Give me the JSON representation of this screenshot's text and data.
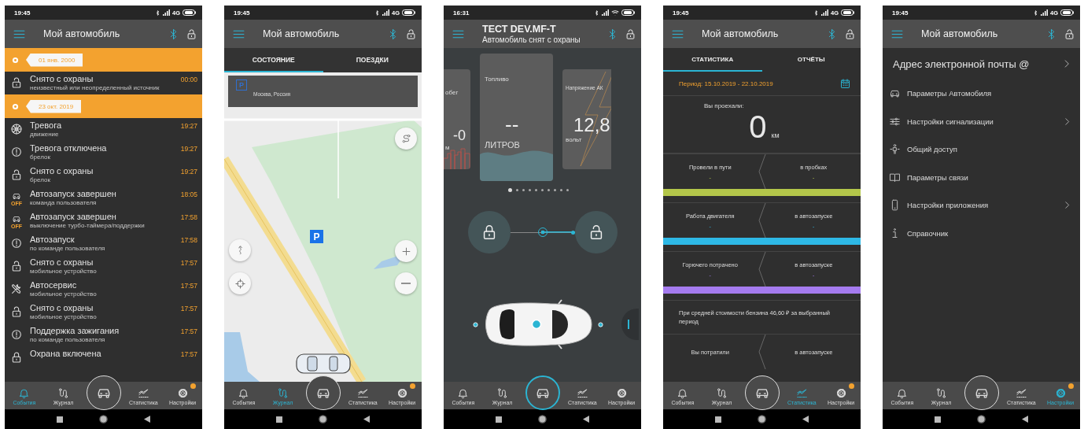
{
  "phones": [
    {
      "status": {
        "time": "19:45",
        "network": "4G"
      },
      "app_bar": {
        "title": "Мой автомобиль"
      },
      "screen": {
        "kind": "events",
        "items": [
          {
            "kind": "date",
            "label": "01 янв. 2000"
          },
          {
            "kind": "disarmed",
            "title": "Снято с охраны",
            "detail": "неизвестный или неопределенный источник",
            "time": "00:00"
          },
          {
            "kind": "date",
            "label": "23 окт. 2019"
          },
          {
            "kind": "alarm",
            "title": "Тревога",
            "detail": "движение",
            "time": "19:27"
          },
          {
            "kind": "alert",
            "title": "Тревога отключена",
            "detail": "брелок",
            "time": "19:27"
          },
          {
            "kind": "disarmed",
            "title": "Снято с охраны",
            "detail": "брелок",
            "time": "19:27"
          },
          {
            "kind": "autostart_off",
            "badge": "OFF",
            "title": "Автозапуск завершен",
            "detail": "команда пользователя",
            "time": "18:05"
          },
          {
            "kind": "autostart_off",
            "badge": "OFF",
            "title": "Автозапуск завершен",
            "detail": "выключение турбо-таймера/поддержки",
            "time": "17:58"
          },
          {
            "kind": "alert",
            "title": "Автозапуск",
            "detail": "по команде пользователя",
            "time": "17:58"
          },
          {
            "kind": "disarmed",
            "title": "Снято с охраны",
            "detail": "мобильное устройство",
            "time": "17:57"
          },
          {
            "kind": "service",
            "title": "Автосервис",
            "detail": "мобильное устройство",
            "time": "17:57"
          },
          {
            "kind": "disarmed",
            "title": "Снято с охраны",
            "detail": "мобильное устройство",
            "time": "17:57"
          },
          {
            "kind": "alert",
            "title": "Поддержка зажигания",
            "detail": "по команде пользователя",
            "time": "17:57"
          },
          {
            "kind": "armed",
            "title": "Охрана включена",
            "time": "17:57"
          }
        ]
      },
      "nav": {
        "center_selected": false,
        "items": [
          {
            "label": "События",
            "selected": true,
            "alert": false
          },
          {
            "label": "Журнал",
            "selected": false,
            "alert": false
          },
          {
            "label": "Статистика",
            "selected": false,
            "alert": false
          },
          {
            "label": "Настройки",
            "selected": false,
            "alert": true
          }
        ]
      }
    },
    {
      "status": {
        "time": "19:45",
        "network": "4G"
      },
      "app_bar": {
        "title": "Мой автомобиль"
      },
      "screen": {
        "kind": "map",
        "tabs": [
          {
            "label": "СОСТОЯНИЕ",
            "selected": true
          },
          {
            "label": "ПОЕЗДКИ",
            "selected": false
          }
        ],
        "info_card": {
          "icon_label": "P",
          "text": "Москва, Россия"
        },
        "parking_marker": "P"
      },
      "nav": {
        "center_selected": false,
        "items": [
          {
            "label": "События",
            "selected": false,
            "alert": false
          },
          {
            "label": "Журнал",
            "selected": true,
            "alert": false
          },
          {
            "label": "Статистика",
            "selected": false,
            "alert": false
          },
          {
            "label": "Настройки",
            "selected": false,
            "alert": true
          }
        ]
      }
    },
    {
      "status": {
        "time": "16:31"
      },
      "app_bar": {
        "title": "ТЕСТ DEV.MF-T",
        "subtitle": "Автомобиль снят с охраны"
      },
      "screen": {
        "kind": "dashboard",
        "cards": [
          {
            "kind": "mileage",
            "title": "обег",
            "value": "-0",
            "unit": "м"
          },
          {
            "kind": "fuel",
            "title": "Топливо",
            "value": "--",
            "unit": "ЛИТРОВ"
          },
          {
            "kind": "voltage",
            "title": "Напряжение АК",
            "value": "12,8",
            "unit": "вольт"
          }
        ],
        "arm_slider": {
          "level": 0.5
        },
        "pages": [
          {
            "selected": true
          },
          {
            "selected": false
          },
          {
            "selected": false
          },
          {
            "selected": false
          },
          {
            "selected": false
          },
          {
            "selected": false
          },
          {
            "selected": false
          },
          {
            "selected": false
          },
          {
            "selected": false
          },
          {
            "selected": false
          }
        ]
      },
      "nav": {
        "center_selected": true,
        "items": [
          {
            "label": "События",
            "selected": false,
            "alert": false
          },
          {
            "label": "Журнал",
            "selected": false,
            "alert": false
          },
          {
            "label": "Статистика",
            "selected": false,
            "alert": false
          },
          {
            "label": "Настройки",
            "selected": false,
            "alert": false
          }
        ]
      }
    },
    {
      "status": {
        "time": "19:45",
        "network": "4G"
      },
      "app_bar": {
        "title": "Мой автомобиль"
      },
      "screen": {
        "kind": "stats",
        "tabs": [
          {
            "label": "СТАТИСТИКА",
            "selected": true
          },
          {
            "label": "ОТЧЁТЫ",
            "selected": false
          }
        ],
        "period": "Период: 15.10.2019 - 22.10.2019",
        "distance_label": "Вы проехали:",
        "distance_value": "0",
        "distance_unit": "км",
        "rows": [
          {
            "left_label": "Провели в пути",
            "left_value": "-",
            "right_label": "в пробках",
            "right_value": "-",
            "color": "#b3c64a"
          },
          {
            "left_label": "Работа двигателя",
            "left_value": "-",
            "right_label": "в автозапуске",
            "right_value": "-",
            "color": "#2eb9e6"
          },
          {
            "left_label": "Горючего потрачено",
            "left_value": "-",
            "right_label": "в автозапуске",
            "right_value": "-",
            "color": "#a57bef"
          }
        ],
        "note": "При средней стоимости бензина 46,60 ₽ за выбранный период",
        "last_row": {
          "left_label": "Вы потратили",
          "right_label": "в автозапуске"
        }
      },
      "nav": {
        "center_selected": false,
        "items": [
          {
            "label": "События",
            "selected": false,
            "alert": false
          },
          {
            "label": "Журнал",
            "selected": false,
            "alert": false
          },
          {
            "label": "Статистика",
            "selected": true,
            "alert": false
          },
          {
            "label": "Настройки",
            "selected": false,
            "alert": true
          }
        ]
      }
    },
    {
      "status": {
        "time": "19:45",
        "network": "4G"
      },
      "app_bar": {
        "title": "Мой автомобиль"
      },
      "screen": {
        "kind": "settings",
        "header": {
          "label": "Адрес электронной почты @",
          "chevron": true
        },
        "items": [
          {
            "label": "Параметры Автомобиля",
            "chevron": false
          },
          {
            "label": "Настройки сигнализации",
            "chevron": true
          },
          {
            "label": "Общий доступ",
            "chevron": false
          },
          {
            "label": "Параметры связи",
            "chevron": false
          },
          {
            "label": "Настройки приложения",
            "chevron": true
          },
          {
            "label": "Справочник",
            "chevron": false
          }
        ]
      },
      "nav": {
        "center_selected": false,
        "items": [
          {
            "label": "События",
            "selected": false,
            "alert": false
          },
          {
            "label": "Журнал",
            "selected": false,
            "alert": false
          },
          {
            "label": "Статистика",
            "selected": false,
            "alert": false
          },
          {
            "label": "Настройки",
            "selected": true,
            "alert": true
          }
        ]
      }
    }
  ]
}
